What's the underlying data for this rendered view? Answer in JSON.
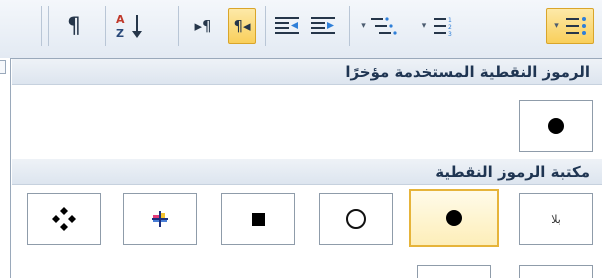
{
  "toolbar": {
    "pilcrow_icon": "¶",
    "sort_icon_label": "A Z",
    "ltr_icon": "▸¶",
    "rtl_icon": "¶◂",
    "align_icon_1": "☰",
    "align_icon_2": "☰",
    "multilevel_icon": "⋮≡",
    "numbering_icon": "≡",
    "bullets_icon": "⋮≡",
    "dropdown_arrow": "▾"
  },
  "panel": {
    "recent_title": "الرموز النقطية المستخدمة مؤخرًا",
    "library_title": "مكتبة الرموز النقطية",
    "none_label": "بلا"
  },
  "colors": {
    "active_fill": "#f9cf5b",
    "active_border": "#d9a52a",
    "header_text": "#1f3552",
    "cell_border": "#8f9caa"
  }
}
